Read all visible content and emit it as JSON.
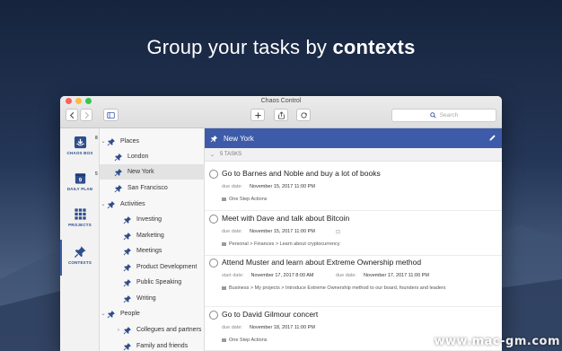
{
  "headline": {
    "prefix": "Group your tasks by ",
    "bold": "contexts"
  },
  "window": {
    "title": "Chaos Control"
  },
  "toolbar": {
    "search_placeholder": "Search"
  },
  "iconbar": {
    "items": [
      {
        "label": "CHAOS BOX",
        "badge": "8"
      },
      {
        "label": "DAILY PLAN",
        "badge": "5"
      },
      {
        "label": "PROJECTS",
        "badge": ""
      },
      {
        "label": "CONTEXTS",
        "badge": ""
      }
    ]
  },
  "sidebar": {
    "groups": [
      {
        "label": "Places",
        "items": [
          "London",
          "New York",
          "San Francisco"
        ]
      },
      {
        "label": "Activities",
        "items": [
          "Investing",
          "Marketing",
          "Meetings",
          "Product Development",
          "Public Speaking",
          "Writing"
        ]
      },
      {
        "label": "People",
        "items": [
          "Collegues and partners",
          "Family and friends"
        ]
      }
    ],
    "selected": "New York"
  },
  "main": {
    "context_title": "New York",
    "task_count": "5 TASKS",
    "tasks": [
      {
        "title": "Go to Barnes and Noble and buy a lot of books",
        "due_label": "due date:",
        "due": "November 15, 2017 11:00 PM",
        "path": "One Step Actions"
      },
      {
        "title": "Meet with Dave and talk about Bitcoin",
        "due_label": "due date:",
        "due": "November 15, 2017 11:00 PM",
        "path": "Personal > Finances > Learn about cryptocurrency"
      },
      {
        "title": "Attend Muster and learn about Extreme Ownership method",
        "start_label": "start date:",
        "start": "November 17, 2017 8:00 AM",
        "due_label": "due date:",
        "due": "November 17, 2017 11:00 PM",
        "path": "Business > My projects > Introduce Extreme Ownership method to our board, founders and leaders"
      },
      {
        "title": "Go to David Gilmour concert",
        "due_label": "due date:",
        "due": "November 18, 2017 11:00 PM",
        "path": "One Step Actions"
      }
    ]
  },
  "colors": {
    "accent": "#3d5ba9",
    "icon_blue": "#2e4d8c"
  },
  "watermark": "www.mac-gm.com"
}
